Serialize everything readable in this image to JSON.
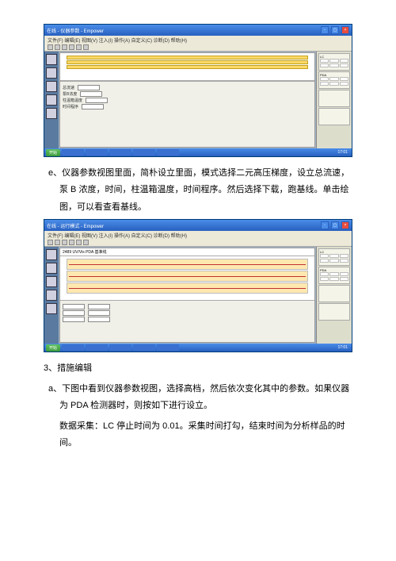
{
  "screenshot1": {
    "title": "在线 - 仪器参数 - Empower",
    "menu": "文件(F) 编辑(E) 视图(V) 注入(I) 操作(A) 自定义(C) 诊断(D) 帮助(H)",
    "rightGroups": [
      "LC",
      "PDA"
    ]
  },
  "screenshot2": {
    "title": "在线 - 运行模式 - Empower",
    "menu": "文件(F) 编辑(E) 视图(V) 注入(I) 操作(A) 自定义(C) 诊断(D) 帮助(H)",
    "chartLabel": "2489 UV/Vis PDA  基准线",
    "rightGroups": [
      "LC",
      "PDA"
    ]
  },
  "taskbar": {
    "start": "开始",
    "clock": "17:01"
  },
  "text": {
    "e": "e、仪器参数视图里面，简朴设立里面，模式选择二元高压梯度，设立总流速，泵 B 浓度，时间，柱温箱温度，时间程序。然后选择下载，跑基线。单击绘图，可以看查看基线。",
    "item3": "3、措施编辑",
    "a": "a、下图中看到仪器参数视图，选择高档，然后依次变化其中的参数。如果仪器为 PDA 检测器时，则按如下进行设立。",
    "a2": "数据采集：LC 停止时间为 0.01。采集时间打勾，结束时间为分析样品的时间。"
  }
}
